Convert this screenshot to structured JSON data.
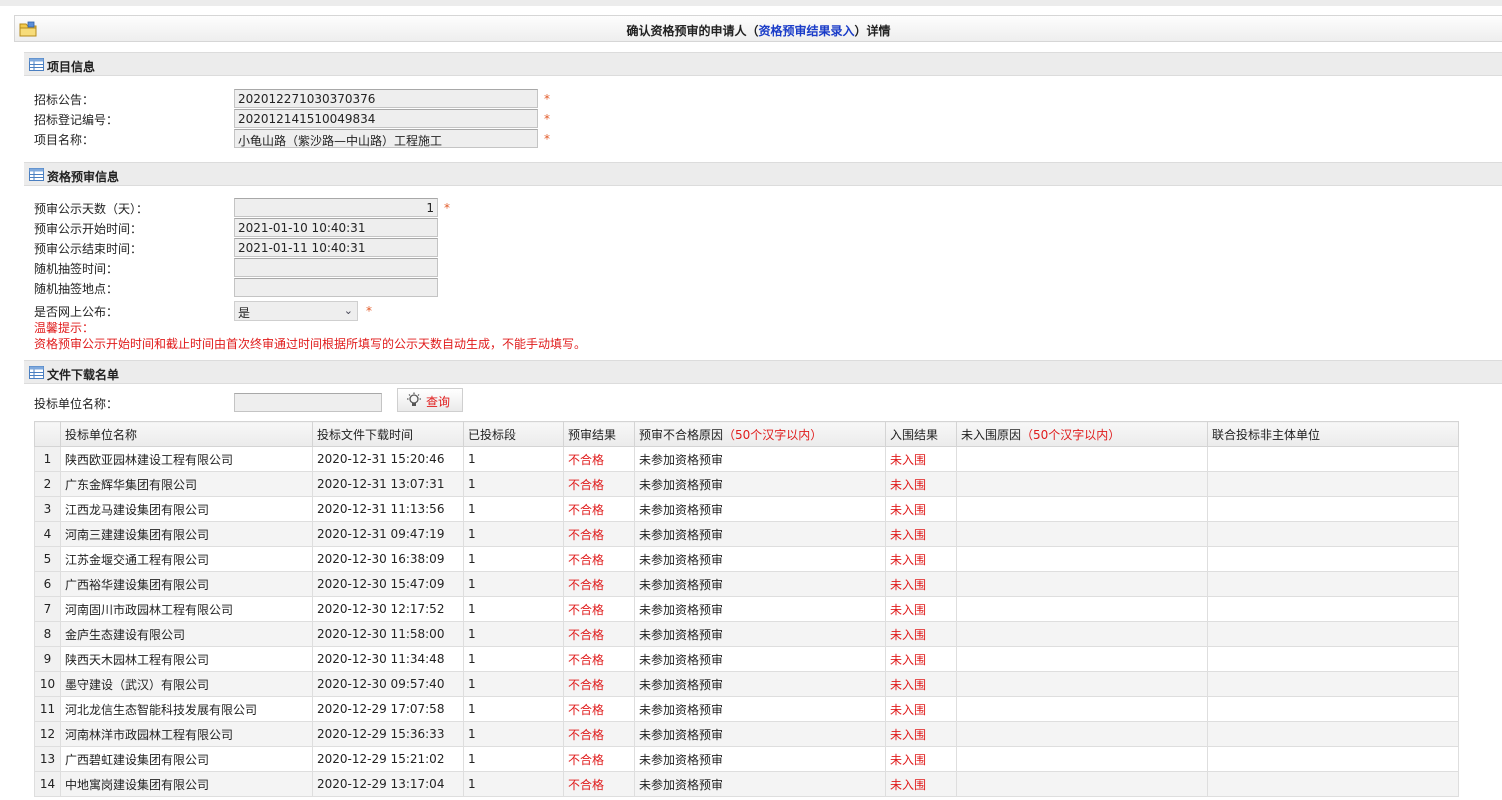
{
  "title": {
    "prefix": "确认资格预审的申请人（",
    "link": "资格预审结果录入",
    "suffix": "）详情"
  },
  "project_section": {
    "heading": "项目信息",
    "fields": [
      {
        "label": "招标公告：",
        "value": "202012271030370376"
      },
      {
        "label": "招标登记编号：",
        "value": "202012141510049834"
      },
      {
        "label": "项目名称：",
        "value": "小龟山路（紫沙路—中山路）工程施工"
      }
    ]
  },
  "prequal_section": {
    "heading": "资格预审信息",
    "days_label": "预审公示天数（天）：",
    "days_value": "1",
    "start_label": "预审公示开始时间：",
    "start_value": "2021-01-10 10:40:31",
    "end_label": "预审公示结束时间：",
    "end_value": "2021-01-11 10:40:31",
    "draw_time_label": "随机抽签时间：",
    "draw_time_value": "",
    "draw_place_label": "随机抽签地点：",
    "draw_place_value": "",
    "publish_label": "是否网上公布：",
    "publish_value": "是",
    "hint_title": "温馨提示：",
    "hint_text": "资格预审公示开始时间和截止时间由首次终审通过时间根据所填写的公示天数自动生成，不能手动填写。"
  },
  "download_section": {
    "heading": "文件下载名单",
    "search_label": "投标单位名称：",
    "search_value": "",
    "query_button": "查询"
  },
  "required_mark": "*",
  "table": {
    "columns": {
      "name": "投标单位名称",
      "time": "投标文件下载时间",
      "section": "已投标段",
      "result": "预审结果",
      "reason_prefix": "预审不合格原因",
      "reason_note": "（50个汉字以内）",
      "inresult": "入围结果",
      "noin_prefix": "未入围原因",
      "noin_note": "（50个汉字以内）",
      "joint": "联合投标非主体单位"
    },
    "rows": [
      {
        "no": "1",
        "name": "陕西欧亚园林建设工程有限公司",
        "time": "2020-12-31 15:20:46",
        "section": "1",
        "result": "不合格",
        "reason": "未参加资格预审",
        "inresult": "未入围",
        "noin": "",
        "joint": ""
      },
      {
        "no": "2",
        "name": "广东金辉华集团有限公司",
        "time": "2020-12-31 13:07:31",
        "section": "1",
        "result": "不合格",
        "reason": "未参加资格预审",
        "inresult": "未入围",
        "noin": "",
        "joint": ""
      },
      {
        "no": "3",
        "name": "江西龙马建设集团有限公司",
        "time": "2020-12-31 11:13:56",
        "section": "1",
        "result": "不合格",
        "reason": "未参加资格预审",
        "inresult": "未入围",
        "noin": "",
        "joint": ""
      },
      {
        "no": "4",
        "name": "河南三建建设集团有限公司",
        "time": "2020-12-31 09:47:19",
        "section": "1",
        "result": "不合格",
        "reason": "未参加资格预审",
        "inresult": "未入围",
        "noin": "",
        "joint": ""
      },
      {
        "no": "5",
        "name": "江苏金堰交通工程有限公司",
        "time": "2020-12-30 16:38:09",
        "section": "1",
        "result": "不合格",
        "reason": "未参加资格预审",
        "inresult": "未入围",
        "noin": "",
        "joint": ""
      },
      {
        "no": "6",
        "name": "广西裕华建设集团有限公司",
        "time": "2020-12-30 15:47:09",
        "section": "1",
        "result": "不合格",
        "reason": "未参加资格预审",
        "inresult": "未入围",
        "noin": "",
        "joint": ""
      },
      {
        "no": "7",
        "name": "河南固川市政园林工程有限公司",
        "time": "2020-12-30 12:17:52",
        "section": "1",
        "result": "不合格",
        "reason": "未参加资格预审",
        "inresult": "未入围",
        "noin": "",
        "joint": ""
      },
      {
        "no": "8",
        "name": "金庐生态建设有限公司",
        "time": "2020-12-30 11:58:00",
        "section": "1",
        "result": "不合格",
        "reason": "未参加资格预审",
        "inresult": "未入围",
        "noin": "",
        "joint": ""
      },
      {
        "no": "9",
        "name": "陕西天木园林工程有限公司",
        "time": "2020-12-30 11:34:48",
        "section": "1",
        "result": "不合格",
        "reason": "未参加资格预审",
        "inresult": "未入围",
        "noin": "",
        "joint": ""
      },
      {
        "no": "10",
        "name": "墨守建设（武汉）有限公司",
        "time": "2020-12-30 09:57:40",
        "section": "1",
        "result": "不合格",
        "reason": "未参加资格预审",
        "inresult": "未入围",
        "noin": "",
        "joint": ""
      },
      {
        "no": "11",
        "name": "河北龙信生态智能科技发展有限公司",
        "time": "2020-12-29 17:07:58",
        "section": "1",
        "result": "不合格",
        "reason": "未参加资格预审",
        "inresult": "未入围",
        "noin": "",
        "joint": ""
      },
      {
        "no": "12",
        "name": "河南林洋市政园林工程有限公司",
        "time": "2020-12-29 15:36:33",
        "section": "1",
        "result": "不合格",
        "reason": "未参加资格预审",
        "inresult": "未入围",
        "noin": "",
        "joint": ""
      },
      {
        "no": "13",
        "name": "广西碧虹建设集团有限公司",
        "time": "2020-12-29 15:21:02",
        "section": "1",
        "result": "不合格",
        "reason": "未参加资格预审",
        "inresult": "未入围",
        "noin": "",
        "joint": ""
      },
      {
        "no": "14",
        "name": "中地寓岗建设集团有限公司",
        "time": "2020-12-29 13:17:04",
        "section": "1",
        "result": "不合格",
        "reason": "未参加资格预审",
        "inresult": "未入围",
        "noin": "",
        "joint": ""
      }
    ]
  }
}
